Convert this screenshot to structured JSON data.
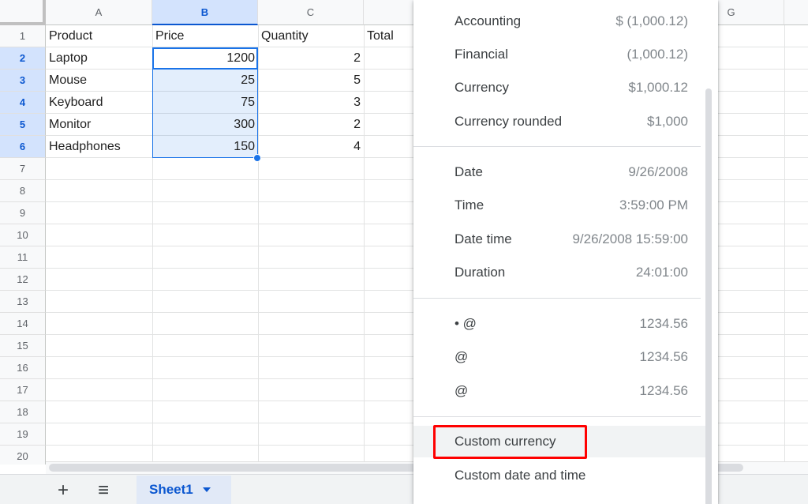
{
  "spreadsheet": {
    "columns": [
      "A",
      "B",
      "C",
      "",
      "G"
    ],
    "row_numbers": [
      "1",
      "2",
      "3",
      "4",
      "5",
      "6",
      "7",
      "8",
      "9",
      "10",
      "11",
      "12",
      "13",
      "14",
      "15",
      "16",
      "17",
      "18",
      "19",
      "20"
    ],
    "selected_column": "B",
    "rows": [
      {
        "a": "Product",
        "b": "Price",
        "c": "Quantity",
        "d": "Total"
      },
      {
        "a": "Laptop",
        "b": "1200",
        "c": "2"
      },
      {
        "a": "Mouse",
        "b": "25",
        "c": "5"
      },
      {
        "a": "Keyboard",
        "b": "75",
        "c": "3"
      },
      {
        "a": "Monitor",
        "b": "300",
        "c": "2"
      },
      {
        "a": "Headphones",
        "b": "150",
        "c": "4"
      }
    ]
  },
  "bottom_bar": {
    "add_sheet": "+",
    "all_sheets": "≡",
    "sheet_tab": "Sheet1"
  },
  "format_menu": {
    "groups": [
      [
        {
          "label": "Accounting",
          "value": "$ (1,000.12)"
        },
        {
          "label": "Financial",
          "value": "(1,000.12)"
        },
        {
          "label": "Currency",
          "value": "$1,000.12"
        },
        {
          "label": "Currency rounded",
          "value": "$1,000"
        }
      ],
      [
        {
          "label": "Date",
          "value": "9/26/2008"
        },
        {
          "label": "Time",
          "value": "3:59:00 PM"
        },
        {
          "label": "Date time",
          "value": "9/26/2008 15:59:00"
        },
        {
          "label": "Duration",
          "value": "24:01:00"
        }
      ],
      [
        {
          "label": "• @",
          "value": "1234.56"
        },
        {
          "label": "@",
          "value": "1234.56"
        },
        {
          "label": "@",
          "value": "1234.56"
        }
      ],
      [
        {
          "label": "Custom currency",
          "value": ""
        },
        {
          "label": "Custom date and time",
          "value": ""
        }
      ]
    ],
    "highlighted_item": "Custom currency",
    "highlight_color": "#ff0000"
  }
}
